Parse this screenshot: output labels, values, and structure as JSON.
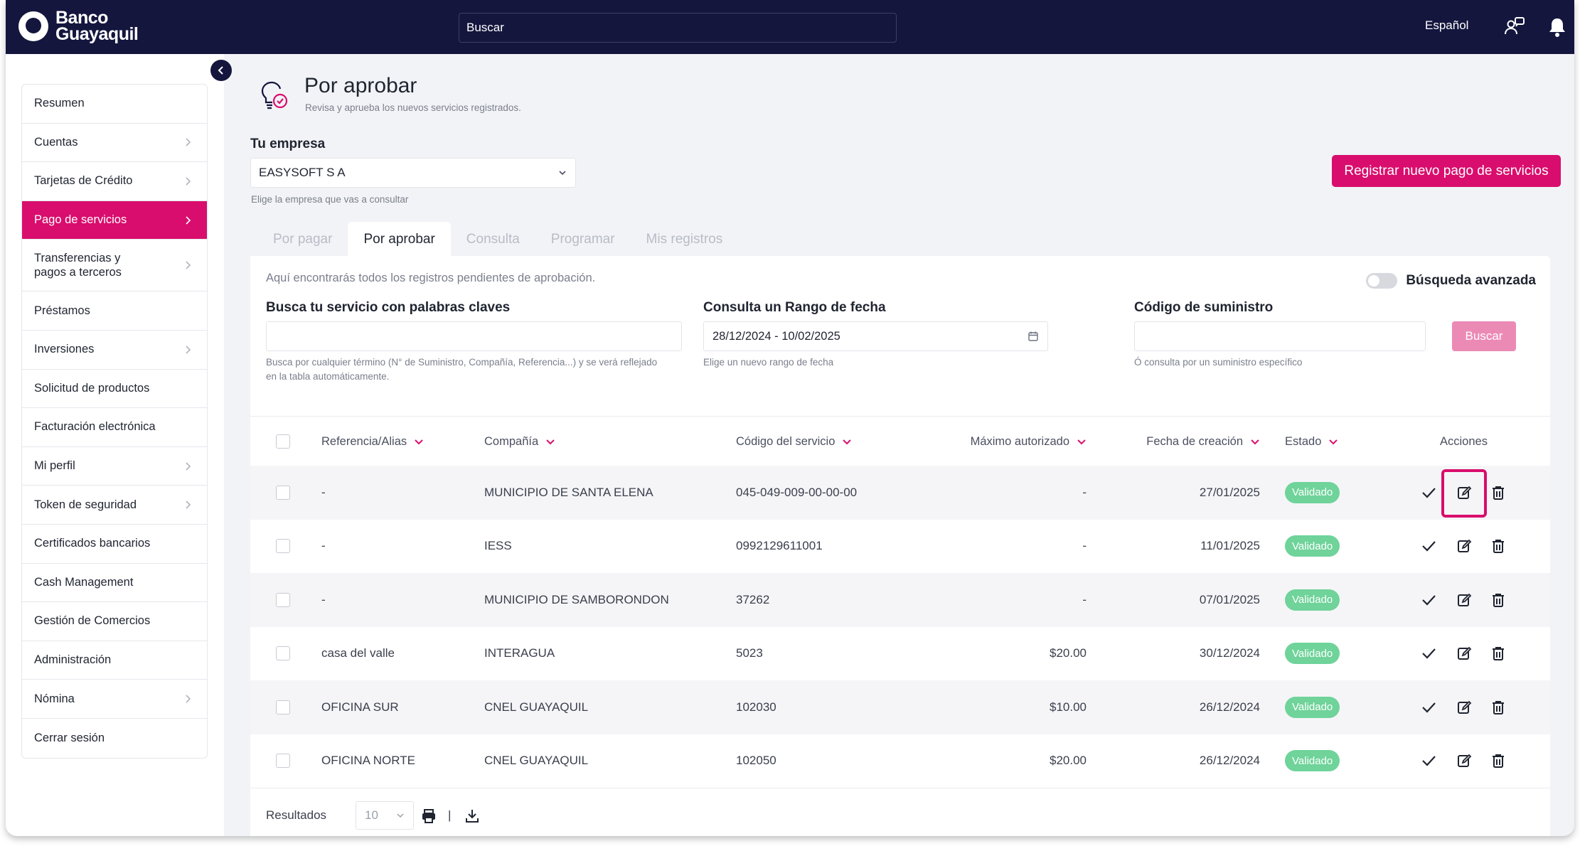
{
  "header": {
    "brand": "Banco Guayaquil",
    "search_placeholder": "Buscar",
    "language": "Español"
  },
  "sidebar": {
    "items": [
      {
        "label": "Resumen",
        "chevron": false
      },
      {
        "label": "Cuentas",
        "chevron": true
      },
      {
        "label": "Tarjetas de Crédito",
        "chevron": true
      },
      {
        "label": "Pago de servicios",
        "chevron": true,
        "active": true
      },
      {
        "label": "Transferencias y pagos a terceros",
        "chevron": true
      },
      {
        "label": "Préstamos",
        "chevron": false
      },
      {
        "label": "Inversiones",
        "chevron": true
      },
      {
        "label": "Solicitud de productos",
        "chevron": false
      },
      {
        "label": "Facturación electrónica",
        "chevron": false
      },
      {
        "label": "Mi perfil",
        "chevron": true
      },
      {
        "label": "Token de seguridad",
        "chevron": true
      },
      {
        "label": "Certificados bancarios",
        "chevron": false
      },
      {
        "label": "Cash Management",
        "chevron": false
      },
      {
        "label": "Gestión de Comercios",
        "chevron": false
      },
      {
        "label": "Administración",
        "chevron": false
      },
      {
        "label": "Nómina",
        "chevron": true
      },
      {
        "label": "Cerrar sesión",
        "chevron": false
      }
    ]
  },
  "page": {
    "title": "Por aprobar",
    "subtitle": "Revisa y aprueba los nuevos servicios registrados.",
    "empresa_label": "Tu empresa",
    "empresa_value": "EASYSOFT S A",
    "empresa_hint": "Elige la empresa que vas a consultar",
    "register_button": "Registrar nuevo pago de servicios"
  },
  "tabs": [
    {
      "label": "Por pagar",
      "active": false
    },
    {
      "label": "Por aprobar",
      "active": true
    },
    {
      "label": "Consulta",
      "active": false
    },
    {
      "label": "Programar",
      "active": false
    },
    {
      "label": "Mis registros",
      "active": false
    }
  ],
  "filters": {
    "note": "Aquí encontrarás todos los registros pendientes de aprobación.",
    "advanced_label": "Búsqueda avanzada",
    "keyword_label": "Busca tu servicio con palabras claves",
    "keyword_value": "",
    "keyword_hint": "Busca por cualquier término (N° de Suministro, Compañía, Referencia...) y se verá reflejado en la tabla automáticamente.",
    "date_label": "Consulta un Rango de fecha",
    "date_value": "28/12/2024 - 10/02/2025",
    "date_hint": "Elige un nuevo rango de fecha",
    "supply_label": "Código de suministro",
    "supply_value": "",
    "supply_hint": "Ó consulta por un suministro específico",
    "search_button": "Buscar"
  },
  "table": {
    "columns": [
      "Referencia/Alias",
      "Compañía",
      "Código del servicio",
      "Máximo autorizado",
      "Fecha de creación",
      "Estado",
      "Acciones"
    ],
    "rows": [
      {
        "ref": "-",
        "company": "MUNICIPIO DE SANTA ELENA",
        "code": "045-049-009-00-00-00",
        "max": "-",
        "date": "27/01/2025",
        "status": "Validado"
      },
      {
        "ref": "-",
        "company": "IESS",
        "code": "0992129611001",
        "max": "-",
        "date": "11/01/2025",
        "status": "Validado"
      },
      {
        "ref": "-",
        "company": "MUNICIPIO DE SAMBORONDON",
        "code": "37262",
        "max": "-",
        "date": "07/01/2025",
        "status": "Validado"
      },
      {
        "ref": "casa del valle",
        "company": "INTERAGUA",
        "code": "5023",
        "max": "$20.00",
        "date": "30/12/2024",
        "status": "Validado"
      },
      {
        "ref": "OFICINA SUR",
        "company": "CNEL GUAYAQUIL",
        "code": "102030",
        "max": "$10.00",
        "date": "26/12/2024",
        "status": "Validado"
      },
      {
        "ref": "OFICINA NORTE",
        "company": "CNEL GUAYAQUIL",
        "code": "102050",
        "max": "$20.00",
        "date": "26/12/2024",
        "status": "Validado"
      }
    ],
    "results_label": "Resultados",
    "page_size": "10",
    "separator": "|"
  },
  "colors": {
    "brand_navy": "#14163e",
    "accent_pink": "#d90d6d",
    "status_green": "#6fd39a"
  }
}
